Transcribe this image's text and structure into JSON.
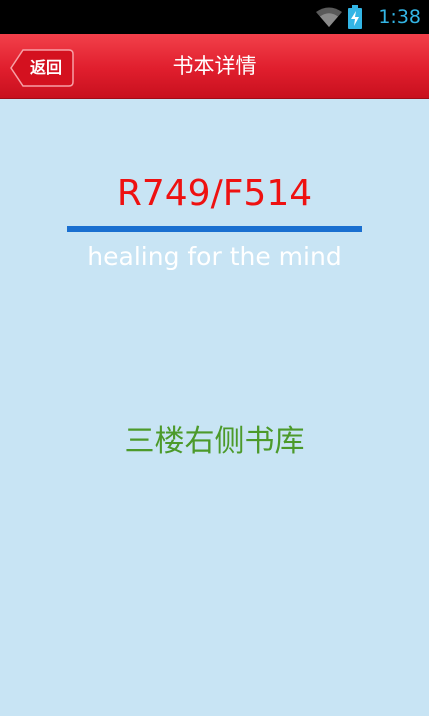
{
  "status_bar": {
    "time": "1:38",
    "icons": [
      "wifi-icon",
      "battery-charging-icon"
    ],
    "time_color": "#33b5e5"
  },
  "header": {
    "back_label": "返回",
    "title": "书本详情",
    "color": "#e01e2d"
  },
  "book": {
    "call_number": "R749/F514",
    "title": "healing for the mind",
    "location": "三楼右侧书库"
  },
  "colors": {
    "background": "#c8e4f4",
    "call_number": "#ee1111",
    "divider": "#1a6fd0",
    "location": "#4c9a2a"
  }
}
